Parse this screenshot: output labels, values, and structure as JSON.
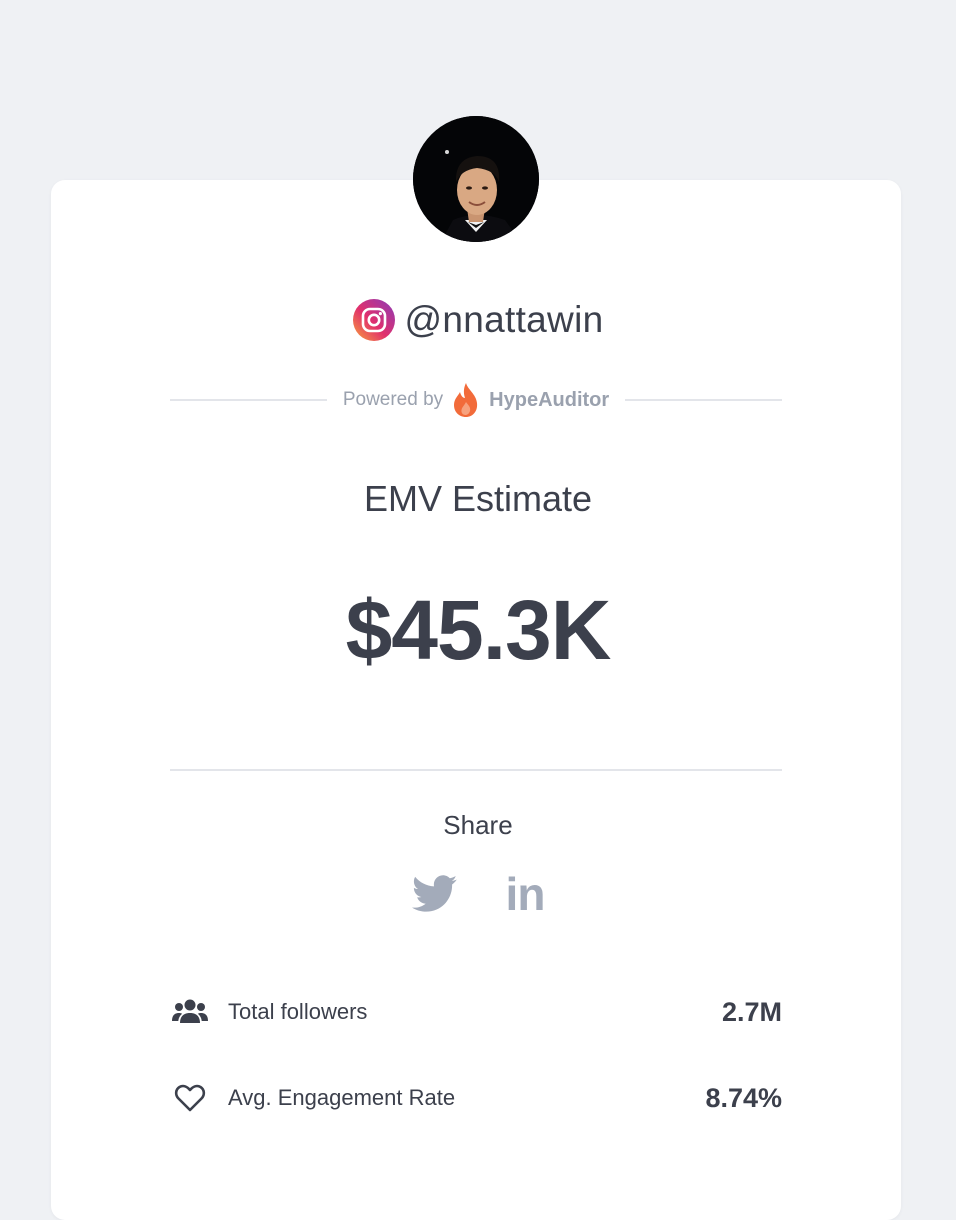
{
  "profile": {
    "avatar_alt": "profile photo",
    "platform_icon": "instagram-icon",
    "handle": "@nnattawin"
  },
  "powered": {
    "prefix": "Powered by",
    "brand": "HypeAuditor",
    "brand_icon": "flame-icon"
  },
  "emv": {
    "title": "EMV Estimate",
    "value": "$45.3K"
  },
  "share": {
    "label": "Share",
    "icons": [
      "twitter-icon",
      "linkedin-icon"
    ],
    "linkedin_text": "in"
  },
  "stats": [
    {
      "icon": "users-icon",
      "label": "Total followers",
      "value": "2.7M"
    },
    {
      "icon": "heart-icon",
      "label": "Avg. Engagement Rate",
      "value": "8.74%"
    }
  ],
  "colors": {
    "background": "#eff1f4",
    "card": "#ffffff",
    "text": "#3c404c",
    "muted": "#9aa1ae",
    "social_icon": "#a3abba",
    "brand_flame": "#f26b3a"
  }
}
